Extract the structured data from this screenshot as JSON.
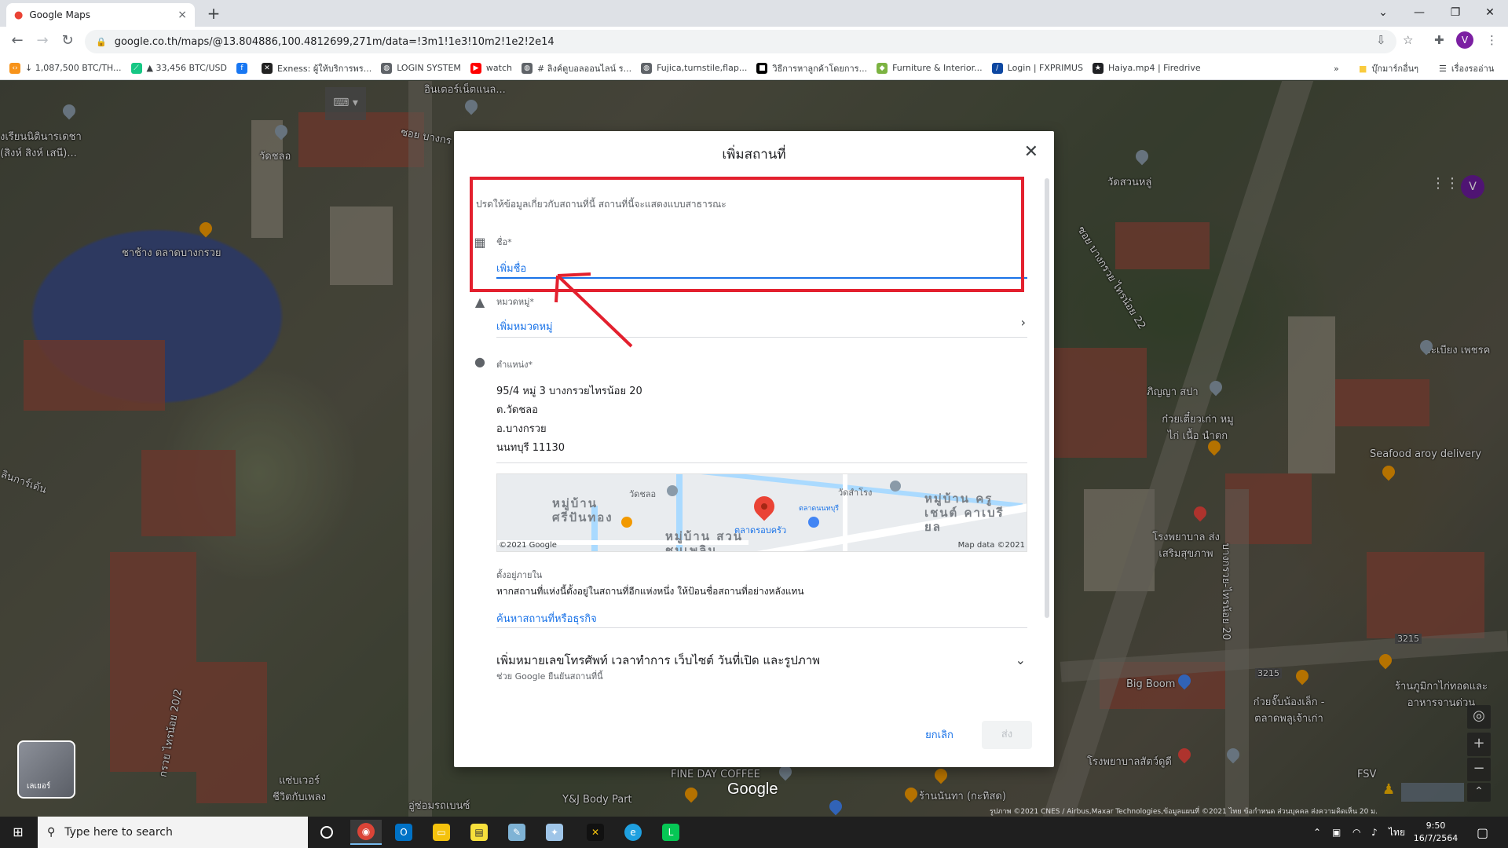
{
  "browser": {
    "tab_title": "Google Maps",
    "tab_close": "×",
    "new_tab": "+",
    "window_controls": [
      "—",
      "❐",
      "✕"
    ],
    "url": "google.co.th/maps/@13.804886,100.4812699,271m/data=!3m1!1e3!10m2!1e2!2e14",
    "profile_initial": "V"
  },
  "bookmarks": [
    {
      "label": "↓ 1,087,500 BTC/TH...",
      "color": "#f7931a",
      "icon": "‹›"
    },
    {
      "label": "▲ 33,456 BTC/USD",
      "color": "#16c784",
      "icon": "⟋"
    },
    {
      "label": "",
      "color": "#1877f2",
      "icon": "f"
    },
    {
      "label": "Exness: ผู้ให้บริการพร...",
      "color": "#222222",
      "icon": "✕"
    },
    {
      "label": "LOGIN SYSTEM",
      "color": "#5f6368",
      "icon": "◍"
    },
    {
      "label": "watch",
      "color": "#ff0000",
      "icon": "▶"
    },
    {
      "label": "# ลิงค์ดูบอลออนไลน์ ร...",
      "color": "#5f6368",
      "icon": "◍"
    },
    {
      "label": "Fujica,turnstile,flap...",
      "color": "#5f6368",
      "icon": "◍"
    },
    {
      "label": "วิธีการหาลูกค้าโดยการ...",
      "color": "#000000",
      "icon": "■"
    },
    {
      "label": "Furniture & Interior...",
      "color": "#7cb342",
      "icon": "◆"
    },
    {
      "label": "Login | FXPRIMUS",
      "color": "#0d47a1",
      "icon": "/"
    },
    {
      "label": "Haiya.mp4 | Firedrive",
      "color": "#202124",
      "icon": "★"
    }
  ],
  "bookmarks_right": {
    "overflow": "»",
    "other_folder": "บุ๊กมาร์กอื่นๆ",
    "reading_list": "เรื่องรออ่าน"
  },
  "map": {
    "labels": [
      "อินเตอร์เน็ตแนล...",
      "งเรียนนิตินารเดชา (สิงห์ สิงห์ เสนี)...",
      "วัดชลอ",
      "ซอย บางกร",
      "ชาช้าง ตลาดบางกรวย",
      "ลินการ์เด้น",
      "วัดสวนหลู่",
      "ซอย บางกรวย ไทรน้อย 22",
      "ระเบียง เพชรค",
      "ภิญญา สปา",
      "ก๋วยเตี๋ยวเก่า หมู ไก่ เนื้อ นำตก",
      "Seafood aroy delivery",
      "โรงพยาบาล ส่งเสริมสุขภาพ",
      "บางกรวย-ไทรน้อย 20",
      "Big Boom",
      "ก๋วยจั๊บน้องเล็ก - ตลาดพลูเจ้าเก่า",
      "ร้านภูมิกาไก่ทอดและอาหารจานด่วน",
      "โรงพยาบาลสัตว์ดูดี",
      "FSV",
      "FINE DAY COFFEE",
      "Y&J Body Part",
      "อู่ซ่อมรถเบนซ์",
      "แซ่บเวอร์ ชีวิตกับเพลง",
      "ร้านนันทา (กะทิสด)",
      "กรวย ไทรน้อย 20/2",
      "3215",
      "3215"
    ],
    "watermark": "Google",
    "layer_label": "เลเยอร์",
    "footer": "รูปภาพ ©2021 CNES / Airbus,Maxar Technologies,ข้อมูลแผนที่ ©2021   ไทย   ข้อกำหนด   ส่วนบุคคล   ส่งความคิดเห็น   20 ม."
  },
  "dialog": {
    "title": "เพิ่มสถานที่",
    "close": "✕",
    "intro": "ปรดให้ข้อมูลเกี่ยวกับสถานที่นี้ สถานที่นี้จะแสดงแบบสาธารณะ",
    "name_label": "ชื่อ*",
    "name_placeholder": "เพิ่มชื่อ",
    "category_label": "หมวดหมู่*",
    "category_placeholder": "เพิ่มหมวดหมู่",
    "location_label": "ตำแหน่ง*",
    "address": [
      "95/4 หมู่ 3 บางกรวยไทรน้อย 20",
      "ต.วัดชลอ",
      "อ.บางกรวย",
      "นนทบุรี 11130"
    ],
    "minimap": {
      "labels": [
        "วัดชลอ",
        "วัดสำโรง",
        "ตลาดรอบครัว",
        "ตลาดนนทบุรี"
      ],
      "areas": [
        "หมู่บ้าน ศรีปันทอง",
        "หมู่บ้าน สวนชมเพลิน",
        "หมู่บ้าน ครูเชนต์ คาเบรียล"
      ],
      "copyright_left": "©2021 Google",
      "copyright_right": "Map data ©2021"
    },
    "inside_label": "ตั้งอยู่ภายใน",
    "inside_text": "หากสถานที่แห่งนี้ตั้งอยู่ในสถานที่อีกแห่งหนึ่ง ให้ป้อนชื่อสถานที่อย่างหลังแทน",
    "inside_link": "ค้นหาสถานที่หรือธุรกิจ",
    "more_title": "เพิ่มหมายเลขโทรศัพท์ เวลาทำการ เว็บไซต์ วันที่เปิด และรูปภาพ",
    "more_sub": "ช่วย Google ยืนยันสถานที่นี้",
    "cancel": "ยกเลิก",
    "send": "ส่ง"
  },
  "taskbar": {
    "search_placeholder": "Type here to search",
    "time": "9:50",
    "date": "16/7/2564",
    "language": "ไทย"
  }
}
